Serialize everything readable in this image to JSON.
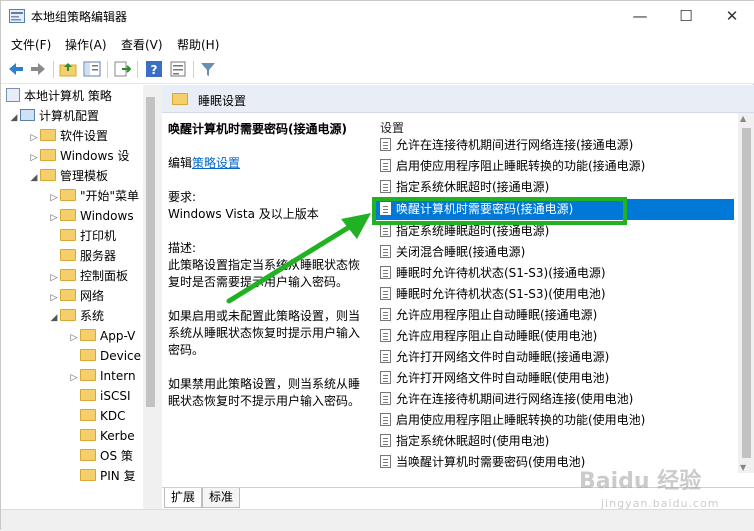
{
  "window": {
    "title": "本地组策略编辑器",
    "controls": {
      "minimize": "—",
      "maximize": "☐",
      "close": "✕"
    }
  },
  "menubar": [
    "文件(F)",
    "操作(A)",
    "查看(V)",
    "帮助(H)"
  ],
  "toolbar": {
    "icons": [
      "back-icon",
      "forward-icon",
      "up-folder-icon",
      "show-tree-icon",
      "export-list-icon",
      "help-icon",
      "properties-icon",
      "filter-icon"
    ]
  },
  "tree": {
    "root": "本地计算机 策略",
    "computer_config": "计算机配置",
    "software_settings": "软件设置",
    "windows_settings": "Windows 设",
    "admin_templates": "管理模板",
    "start_menu": "\"开始\"菜单",
    "windows_components": "Windows",
    "printers": "打印机",
    "server": "服务器",
    "control_panel": "控制面板",
    "network": "网络",
    "system": "系统",
    "app_v": "App-V",
    "device": "Device",
    "internet": "Intern",
    "iscsi": "iSCSI",
    "kdc": "KDC",
    "kerberos": "Kerbe",
    "os_policy": "OS 策",
    "pin": "PIN 复"
  },
  "header": {
    "title": "睡眠设置"
  },
  "description": {
    "policy_title": "唤醒计算机时需要密码(接通电源)",
    "edit_prefix": "编辑",
    "edit_link": "策略设置",
    "requirements_label": "要求:",
    "requirements_value": "Windows Vista 及以上版本",
    "desc_label": "描述:",
    "desc_p1_l1": "此策略设置指定当系统从睡眠状态恢",
    "desc_p1_l2": "复时是否需要提示用户输入密码。",
    "desc_p2_l1": "如果启用或未配置此策略设置，则当",
    "desc_p2_l2": "系统从睡眠状态恢复时提示用户输入",
    "desc_p2_l3": "密码。",
    "desc_p3_l1": "如果禁用此策略设置，则当系统从睡",
    "desc_p3_l2": "眠状态恢复时不提示用户输入密码。"
  },
  "list": {
    "column_header": "设置",
    "items": [
      "允许在连接待机期间进行网络连接(接通电源)",
      "启用使应用程序阻止睡眠转换的功能(接通电源)",
      "指定系统休眠超时(接通电源)",
      "唤醒计算机时需要密码(接通电源)",
      "指定系统睡眠超时(接通电源)",
      "关闭混合睡眠(接通电源)",
      "睡眠时允许待机状态(S1-S3)(接通电源)",
      "睡眠时允许待机状态(S1-S3)(使用电池)",
      "允许应用程序阻止自动睡眠(接通电源)",
      "允许应用程序阻止自动睡眠(使用电池)",
      "允许打开网络文件时自动睡眠(接通电源)",
      "允许打开网络文件时自动睡眠(使用电池)",
      "允许在连接待机期间进行网络连接(使用电池)",
      "启用使应用程序阻止睡眠转换的功能(使用电池)",
      "指定系统休眠超时(使用电池)",
      "当唤醒计算机时需要密码(使用电池)"
    ],
    "selected_index": 3
  },
  "tabs": {
    "extended": "扩展",
    "standard": "标准"
  },
  "watermark": {
    "brand": "Baidu 经验",
    "sub": "jingyan.baidu.com"
  },
  "colors": {
    "selection": "#0078d7",
    "annotation": "#22b122",
    "link": "#0066cc"
  }
}
